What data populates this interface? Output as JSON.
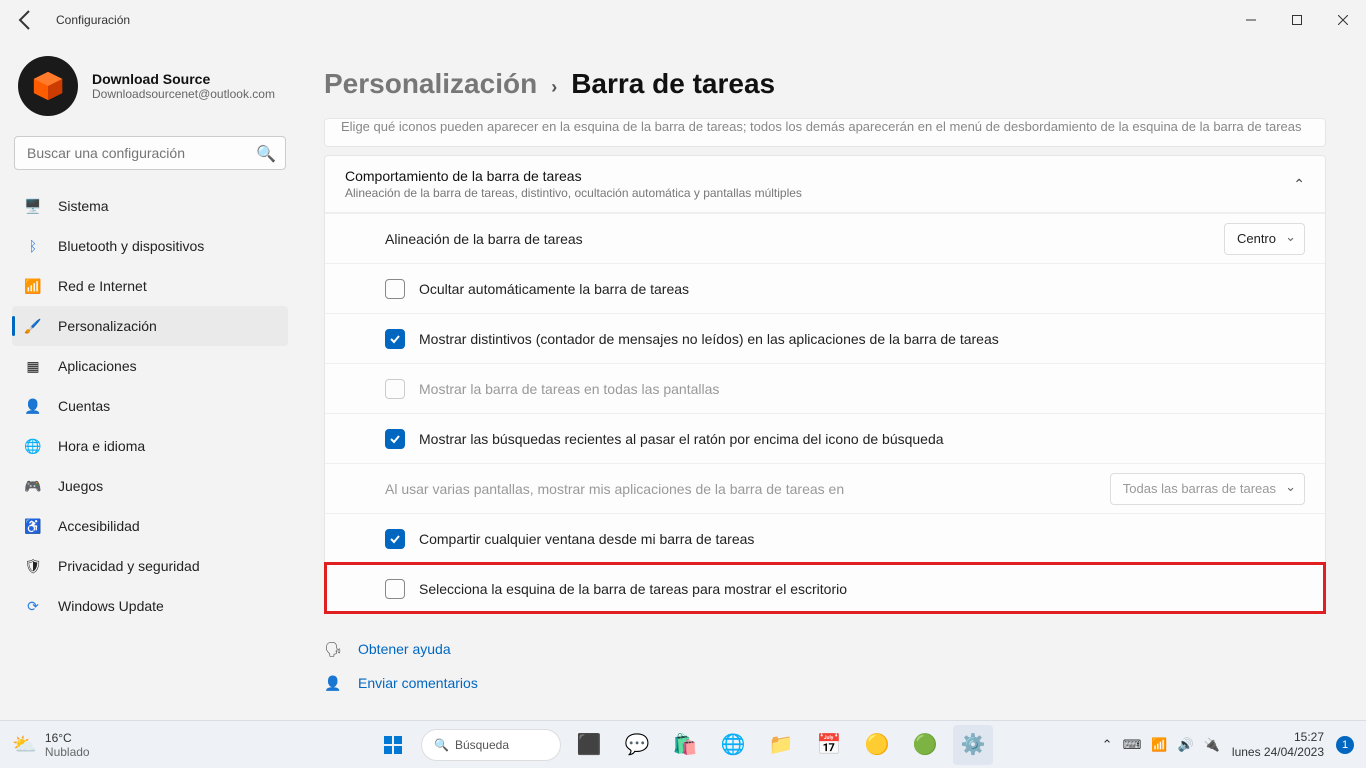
{
  "window": {
    "title": "Configuración"
  },
  "account": {
    "name": "Download Source",
    "email": "Downloadsourcenet@outlook.com"
  },
  "search": {
    "placeholder": "Buscar una configuración"
  },
  "nav": {
    "items": [
      {
        "label": "Sistema",
        "icon": "🖥️"
      },
      {
        "label": "Bluetooth y dispositivos",
        "icon": "ᛒ"
      },
      {
        "label": "Red e Internet",
        "icon": "📶"
      },
      {
        "label": "Personalización",
        "icon": "🖌️"
      },
      {
        "label": "Aplicaciones",
        "icon": "▦"
      },
      {
        "label": "Cuentas",
        "icon": "👤"
      },
      {
        "label": "Hora e idioma",
        "icon": "🌐"
      },
      {
        "label": "Juegos",
        "icon": "🎮"
      },
      {
        "label": "Accesibilidad",
        "icon": "♿"
      },
      {
        "label": "Privacidad y seguridad",
        "icon": "🛡"
      },
      {
        "label": "Windows Update",
        "icon": "⟳"
      }
    ],
    "active_index": 3
  },
  "breadcrumb": {
    "parent": "Personalización",
    "sep": "›",
    "leaf": "Barra de tareas"
  },
  "clipped_card": {
    "subtitle": "Elige qué iconos pueden aparecer en la esquina de la barra de tareas; todos los demás aparecerán en el menú de desbordamiento de la esquina de la barra de tareas"
  },
  "behaviors": {
    "title": "Comportamiento de la barra de tareas",
    "subtitle": "Alineación de la barra de tareas, distintivo, ocultación automática y pantallas múltiples",
    "rows": {
      "alignment": {
        "label": "Alineación de la barra de tareas",
        "value": "Centro"
      },
      "autohide": {
        "label": "Ocultar automáticamente la barra de tareas",
        "checked": false
      },
      "badges": {
        "label": "Mostrar distintivos (contador de mensajes no leídos) en las aplicaciones de la barra de tareas",
        "checked": true
      },
      "all_displays": {
        "label": "Mostrar la barra de tareas en todas las pantallas",
        "checked": false
      },
      "recent_search": {
        "label": "Mostrar las búsquedas recientes al pasar el ratón por encima del icono de búsqueda",
        "checked": true
      },
      "multi_display": {
        "label": "Al usar varias pantallas, mostrar mis aplicaciones de la barra de tareas en",
        "value": "Todas las barras de tareas"
      },
      "share_window": {
        "label": "Compartir cualquier ventana desde mi barra de tareas",
        "checked": true
      },
      "desktop_corner": {
        "label": "Selecciona la esquina de la barra de tareas para mostrar el escritorio",
        "checked": false
      }
    }
  },
  "footer_links": {
    "help": "Obtener ayuda",
    "feedback": "Enviar comentarios"
  },
  "taskbar": {
    "weather_temp": "16°C",
    "weather_desc": "Nublado",
    "search_label": "Búsqueda",
    "time": "15:27",
    "date": "lunes 24/04/2023",
    "notif_count": "1"
  }
}
